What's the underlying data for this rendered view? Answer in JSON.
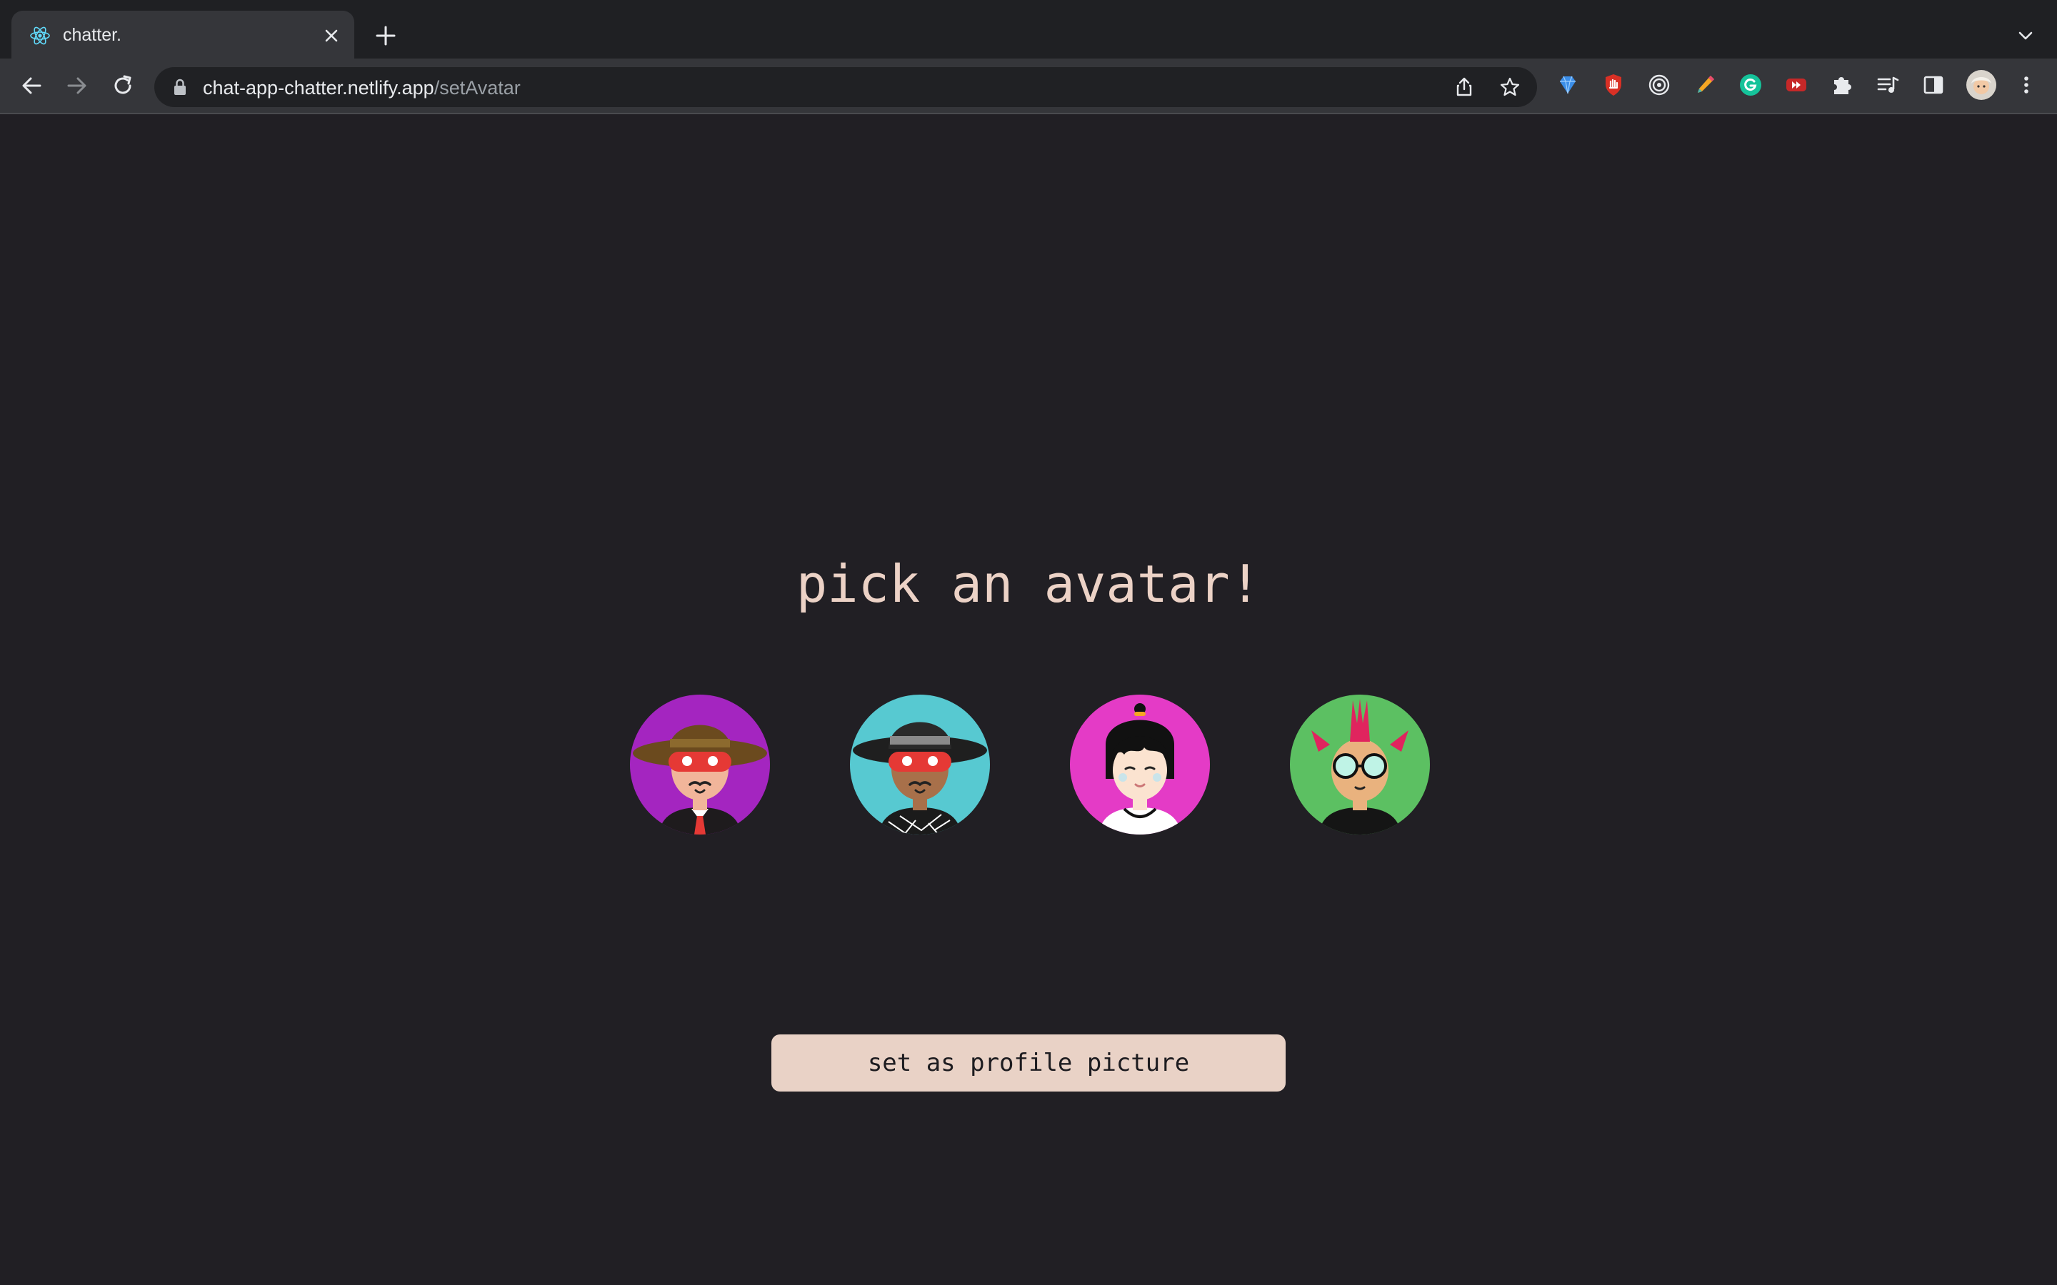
{
  "browser": {
    "tab": {
      "title": "chatter.",
      "favicon": "react-atom-icon"
    },
    "address_bar": {
      "domain": "chat-app-chatter.netlify.app",
      "path": "/setAvatar"
    },
    "extensions": [
      "diamond-extension-icon",
      "hand-stop-extension-icon",
      "target-extension-icon",
      "pen-extension-icon",
      "grammarly-extension-icon",
      "video-extension-icon",
      "puzzle-piece-icon",
      "media-controls-icon",
      "side-panel-icon",
      "profile-avatar-icon",
      "kebab-menu-icon"
    ]
  },
  "page": {
    "heading": "pick an avatar!",
    "avatars": [
      {
        "name": "avatar-masked-man-fedora",
        "bg": "#a425c0"
      },
      {
        "name": "avatar-masked-man-hat-teal",
        "bg": "#57c9d1"
      },
      {
        "name": "avatar-girl-black-hair",
        "bg": "#e43bc6"
      },
      {
        "name": "avatar-punk-glasses",
        "bg": "#5cc062"
      }
    ],
    "button_label": "set as profile picture"
  },
  "colors": {
    "page_bg": "#211f24",
    "accent": "#ecd2c6",
    "button_bg": "#e9d2c6",
    "tabstrip_bg": "#1f2023",
    "toolbar_bg": "#35363a"
  }
}
